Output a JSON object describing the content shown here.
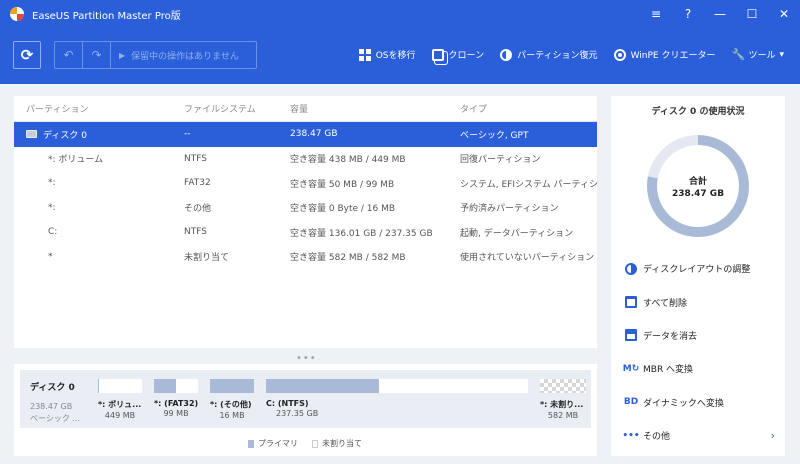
{
  "window": {
    "title": "EaseUS Partition Master Pro版",
    "controls": [
      "≡",
      "?",
      "—",
      "☐",
      "✕"
    ]
  },
  "toolbar": {
    "refresh_icon": "⟳",
    "undo_icon": "↶",
    "redo_icon": "↷",
    "apply_icon": "▶",
    "apply_label": "保留中の操作はありません",
    "items": [
      {
        "icon": "windows-icon",
        "label": "OSを移行"
      },
      {
        "icon": "clone-icon",
        "label": "クローン"
      },
      {
        "icon": "partition-recovery-icon",
        "label": "パーティション復元"
      },
      {
        "icon": "winpe-icon",
        "label": "WinPE クリエーター"
      },
      {
        "icon": "wrench-icon",
        "label": "ツール",
        "chevron": "▾"
      }
    ]
  },
  "table": {
    "headers": [
      "パーティション",
      "ファイルシステム",
      "容量",
      "タイプ"
    ],
    "rows": [
      {
        "name": "ディスク 0",
        "fs": "--",
        "cap": "238.47 GB",
        "type": "ベーシック, GPT",
        "disk": true
      },
      {
        "name": "*: ボリューム",
        "fs": "NTFS",
        "cap": "空き容量 438 MB / 449 MB",
        "type": "回復パーティション"
      },
      {
        "name": "*:",
        "fs": "FAT32",
        "cap": "空き容量 50 MB / 99 MB",
        "type": "システム, EFIシステム パーティション"
      },
      {
        "name": "*:",
        "fs": "その他",
        "cap": "空き容量 0 Byte / 16 MB",
        "type": "予約済みパーティション"
      },
      {
        "name": "C:",
        "fs": "NTFS",
        "cap": "空き容量 136.01 GB / 237.35 GB",
        "type": "起動, データパーティション"
      },
      {
        "name": "*",
        "fs": "未割り当て",
        "cap": "空き容量 582 MB / 582 MB",
        "type": "使用されていないパーティション"
      }
    ]
  },
  "diskmap": {
    "name": "ディスク 0",
    "size": "238.47 GB",
    "kind": "ベーシック ...",
    "partitions": [
      {
        "label": "*: ボリュ...",
        "size": "449 MB",
        "used_fraction": 0.03
      },
      {
        "label": "*: (FAT32)",
        "size": "99 MB",
        "used_fraction": 0.5
      },
      {
        "label": "*: (その他)",
        "size": "16 MB",
        "used_fraction": 1.0
      },
      {
        "label": "C: (NTFS)",
        "size": "237.35 GB",
        "used_fraction": 0.43
      },
      {
        "label": "*: 未割り...",
        "size": "582 MB",
        "used_fraction": 0
      }
    ],
    "legend": {
      "primary": "プライマリ",
      "unallocated": "未割り当て"
    },
    "dots": "•••"
  },
  "side": {
    "title": "ディスク 0 の使用状況",
    "total_label": "合計",
    "total_value": "238.47 GB",
    "used_fraction": 0.78,
    "actions": [
      {
        "icon": "disk-layout-icon",
        "label": "ディスクレイアウトの調整"
      },
      {
        "icon": "trash-icon",
        "label": "すべて削除"
      },
      {
        "icon": "wipe-data-icon",
        "label": "データを消去"
      },
      {
        "icon": "mbr-convert-icon",
        "glyph": "M↻",
        "label": "MBR へ変換"
      },
      {
        "icon": "dynamic-convert-icon",
        "glyph": "BD",
        "label": "ダイナミックへ変換"
      },
      {
        "icon": "more-icon",
        "glyph": "•••",
        "label": "その他",
        "chevron": "›"
      }
    ]
  },
  "colors": {
    "accent": "#2b5fd9",
    "primary_fill": "#a9bad6",
    "panel_bg": "#eef1f6"
  }
}
